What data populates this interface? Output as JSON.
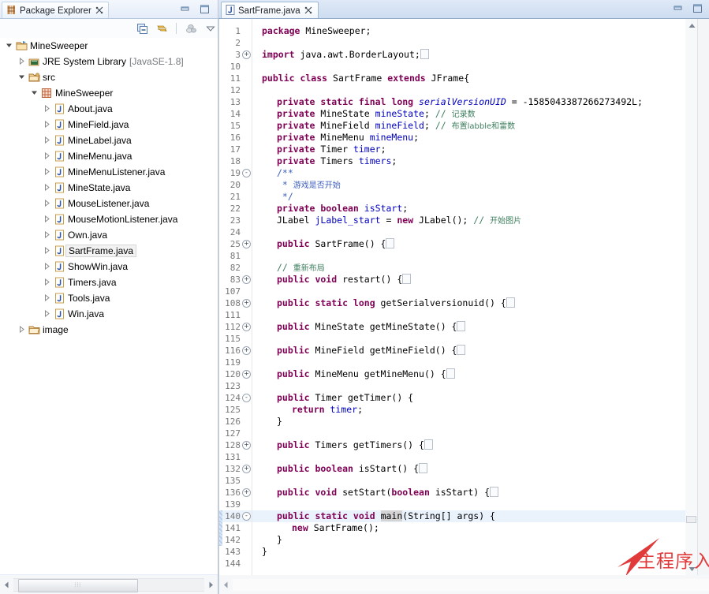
{
  "window": {
    "minimize_icon": "minimize-icon",
    "maximize_icon": "maximize-icon"
  },
  "package_explorer": {
    "tab_label": "Package Explorer",
    "tab_icon": "package-explorer-icon",
    "close_icon": "✕",
    "toolbar": [
      {
        "name": "collapse-all-button",
        "icon": "collapse-all-icon"
      },
      {
        "name": "link-with-editor-button",
        "icon": "link-editor-icon"
      },
      {
        "name": "focus-on-active-task-button",
        "icon": "focus-task-icon"
      },
      {
        "name": "view-menu-button",
        "icon": "chevron-down-icon"
      }
    ],
    "tree": [
      {
        "indent": 0,
        "twisty": "▾",
        "icon": "project-icon",
        "label": "MineSweeper",
        "dim": "",
        "selected": false
      },
      {
        "indent": 1,
        "twisty": "▸",
        "icon": "jre-library-icon",
        "label": "JRE System Library",
        "dim": "[JavaSE-1.8]",
        "selected": false
      },
      {
        "indent": 1,
        "twisty": "▾",
        "icon": "source-folder-icon",
        "label": "src",
        "dim": "",
        "selected": false
      },
      {
        "indent": 2,
        "twisty": "▾",
        "icon": "package-icon",
        "label": "MineSweeper",
        "dim": "",
        "selected": false
      },
      {
        "indent": 3,
        "twisty": "▸",
        "icon": "java-file-icon",
        "label": "About.java",
        "dim": "",
        "selected": false
      },
      {
        "indent": 3,
        "twisty": "▸",
        "icon": "java-file-icon",
        "label": "MineField.java",
        "dim": "",
        "selected": false
      },
      {
        "indent": 3,
        "twisty": "▸",
        "icon": "java-file-icon",
        "label": "MineLabel.java",
        "dim": "",
        "selected": false
      },
      {
        "indent": 3,
        "twisty": "▸",
        "icon": "java-file-icon",
        "label": "MineMenu.java",
        "dim": "",
        "selected": false
      },
      {
        "indent": 3,
        "twisty": "▸",
        "icon": "java-file-icon",
        "label": "MineMenuListener.java",
        "dim": "",
        "selected": false
      },
      {
        "indent": 3,
        "twisty": "▸",
        "icon": "java-file-icon",
        "label": "MineState.java",
        "dim": "",
        "selected": false
      },
      {
        "indent": 3,
        "twisty": "▸",
        "icon": "java-file-icon",
        "label": "MouseListener.java",
        "dim": "",
        "selected": false
      },
      {
        "indent": 3,
        "twisty": "▸",
        "icon": "java-file-icon",
        "label": "MouseMotionListener.java",
        "dim": "",
        "selected": false
      },
      {
        "indent": 3,
        "twisty": "▸",
        "icon": "java-file-icon",
        "label": "Own.java",
        "dim": "",
        "selected": false
      },
      {
        "indent": 3,
        "twisty": "▸",
        "icon": "java-file-icon",
        "label": "SartFrame.java",
        "dim": "",
        "selected": true
      },
      {
        "indent": 3,
        "twisty": "▸",
        "icon": "java-file-icon",
        "label": "ShowWin.java",
        "dim": "",
        "selected": false
      },
      {
        "indent": 3,
        "twisty": "▸",
        "icon": "java-file-icon",
        "label": "Timers.java",
        "dim": "",
        "selected": false
      },
      {
        "indent": 3,
        "twisty": "▸",
        "icon": "java-file-icon",
        "label": "Tools.java",
        "dim": "",
        "selected": false
      },
      {
        "indent": 3,
        "twisty": "▸",
        "icon": "java-file-icon",
        "label": "Win.java",
        "dim": "",
        "selected": false
      },
      {
        "indent": 1,
        "twisty": "▸",
        "icon": "folder-icon",
        "label": "image",
        "dim": "",
        "selected": false
      }
    ],
    "hscroll": {
      "left_arrow": "◀",
      "right_arrow": "▶",
      "grip": "⦙⦙⦙"
    }
  },
  "editor": {
    "tab_label": "SartFrame.java",
    "tab_icon": "java-file-icon",
    "close_icon": "✕",
    "vscroll": {
      "up_arrow": "▲",
      "down_arrow": "▼"
    },
    "hscroll": {
      "left_arrow": "◁"
    },
    "lines": [
      {
        "n": "1",
        "fold": "",
        "indent": 0,
        "hl": false,
        "changed": false,
        "tokens": [
          {
            "t": "kw",
            "v": "package"
          },
          {
            "t": "plain",
            "v": " MineSweeper;"
          }
        ]
      },
      {
        "n": "2",
        "fold": "",
        "indent": 0,
        "hl": false,
        "changed": false,
        "tokens": []
      },
      {
        "n": "3",
        "fold": "+",
        "indent": 0,
        "hl": false,
        "changed": false,
        "tokens": [
          {
            "t": "kw",
            "v": "import"
          },
          {
            "t": "plain",
            "v": " java.awt.BorderLayout;"
          },
          {
            "t": "box",
            "v": ""
          }
        ]
      },
      {
        "n": "10",
        "fold": "",
        "indent": 0,
        "hl": false,
        "changed": false,
        "tokens": []
      },
      {
        "n": "11",
        "fold": "",
        "indent": 0,
        "hl": false,
        "changed": false,
        "tokens": [
          {
            "t": "kw",
            "v": "public class"
          },
          {
            "t": "plain",
            "v": " SartFrame "
          },
          {
            "t": "kw",
            "v": "extends"
          },
          {
            "t": "plain",
            "v": " JFrame{"
          }
        ]
      },
      {
        "n": "12",
        "fold": "",
        "indent": 0,
        "hl": false,
        "changed": false,
        "tokens": []
      },
      {
        "n": "13",
        "fold": "",
        "indent": 1,
        "hl": false,
        "changed": false,
        "tokens": [
          {
            "t": "kw",
            "v": "private static final long"
          },
          {
            "t": "plain",
            "v": " "
          },
          {
            "t": "stat",
            "v": "serialVersionUID"
          },
          {
            "t": "plain",
            "v": " = -1585043387266273492L;"
          }
        ]
      },
      {
        "n": "14",
        "fold": "",
        "indent": 1,
        "hl": false,
        "changed": false,
        "tokens": [
          {
            "t": "kw",
            "v": "private"
          },
          {
            "t": "plain",
            "v": " MineState "
          },
          {
            "t": "fld",
            "v": "mineState"
          },
          {
            "t": "plain",
            "v": "; "
          },
          {
            "t": "cmt",
            "v": "// "
          },
          {
            "t": "cmtcjk",
            "v": "记录数"
          }
        ]
      },
      {
        "n": "15",
        "fold": "",
        "indent": 1,
        "hl": false,
        "changed": false,
        "tokens": [
          {
            "t": "kw",
            "v": "private"
          },
          {
            "t": "plain",
            "v": " MineField "
          },
          {
            "t": "fld",
            "v": "mineField"
          },
          {
            "t": "plain",
            "v": "; "
          },
          {
            "t": "cmt",
            "v": "// "
          },
          {
            "t": "cmtcjk",
            "v": "布置labble和雷数"
          }
        ]
      },
      {
        "n": "16",
        "fold": "",
        "indent": 1,
        "hl": false,
        "changed": false,
        "tokens": [
          {
            "t": "kw",
            "v": "private"
          },
          {
            "t": "plain",
            "v": " MineMenu "
          },
          {
            "t": "fld",
            "v": "mineMenu"
          },
          {
            "t": "plain",
            "v": ";"
          }
        ]
      },
      {
        "n": "17",
        "fold": "",
        "indent": 1,
        "hl": false,
        "changed": false,
        "tokens": [
          {
            "t": "kw",
            "v": "private"
          },
          {
            "t": "plain",
            "v": " Timer "
          },
          {
            "t": "fld",
            "v": "timer"
          },
          {
            "t": "plain",
            "v": ";"
          }
        ]
      },
      {
        "n": "18",
        "fold": "",
        "indent": 1,
        "hl": false,
        "changed": false,
        "tokens": [
          {
            "t": "kw",
            "v": "private"
          },
          {
            "t": "plain",
            "v": " Timers "
          },
          {
            "t": "fld",
            "v": "timers"
          },
          {
            "t": "plain",
            "v": ";"
          }
        ]
      },
      {
        "n": "19",
        "fold": "-",
        "indent": 1,
        "hl": false,
        "changed": false,
        "tokens": [
          {
            "t": "jdoc",
            "v": "/**"
          }
        ]
      },
      {
        "n": "20",
        "fold": "",
        "indent": 1,
        "hl": false,
        "changed": false,
        "tokens": [
          {
            "t": "jdoc",
            "v": " * "
          },
          {
            "t": "jdoccjk",
            "v": "游戏是否开始"
          }
        ]
      },
      {
        "n": "21",
        "fold": "",
        "indent": 1,
        "hl": false,
        "changed": false,
        "tokens": [
          {
            "t": "jdoc",
            "v": " */"
          }
        ]
      },
      {
        "n": "22",
        "fold": "",
        "indent": 1,
        "hl": false,
        "changed": false,
        "tokens": [
          {
            "t": "kw",
            "v": "private boolean"
          },
          {
            "t": "plain",
            "v": " "
          },
          {
            "t": "fld",
            "v": "isStart"
          },
          {
            "t": "plain",
            "v": ";"
          }
        ]
      },
      {
        "n": "23",
        "fold": "",
        "indent": 1,
        "hl": false,
        "changed": false,
        "tokens": [
          {
            "t": "plain",
            "v": "JLabel "
          },
          {
            "t": "fld",
            "v": "jLabel_start"
          },
          {
            "t": "plain",
            "v": " = "
          },
          {
            "t": "kw",
            "v": "new"
          },
          {
            "t": "plain",
            "v": " JLabel(); "
          },
          {
            "t": "cmt",
            "v": "// "
          },
          {
            "t": "cmtcjk",
            "v": "开始图片"
          }
        ]
      },
      {
        "n": "24",
        "fold": "",
        "indent": 0,
        "hl": false,
        "changed": false,
        "tokens": []
      },
      {
        "n": "25",
        "fold": "+",
        "indent": 1,
        "hl": false,
        "changed": false,
        "tokens": [
          {
            "t": "kw",
            "v": "public"
          },
          {
            "t": "plain",
            "v": " SartFrame() {"
          },
          {
            "t": "box",
            "v": ""
          }
        ]
      },
      {
        "n": "81",
        "fold": "",
        "indent": 0,
        "hl": false,
        "changed": false,
        "tokens": []
      },
      {
        "n": "82",
        "fold": "",
        "indent": 1,
        "hl": false,
        "changed": false,
        "tokens": [
          {
            "t": "cmt",
            "v": "// "
          },
          {
            "t": "cmtcjk",
            "v": "重新布局"
          }
        ]
      },
      {
        "n": "83",
        "fold": "+",
        "indent": 1,
        "hl": false,
        "changed": false,
        "tokens": [
          {
            "t": "kw",
            "v": "public void"
          },
          {
            "t": "plain",
            "v": " restart() {"
          },
          {
            "t": "box",
            "v": ""
          }
        ]
      },
      {
        "n": "107",
        "fold": "",
        "indent": 0,
        "hl": false,
        "changed": false,
        "tokens": []
      },
      {
        "n": "108",
        "fold": "+",
        "indent": 1,
        "hl": false,
        "changed": false,
        "tokens": [
          {
            "t": "kw",
            "v": "public static long"
          },
          {
            "t": "plain",
            "v": " getSerialversionuid() {"
          },
          {
            "t": "box",
            "v": ""
          }
        ]
      },
      {
        "n": "111",
        "fold": "",
        "indent": 0,
        "hl": false,
        "changed": false,
        "tokens": []
      },
      {
        "n": "112",
        "fold": "+",
        "indent": 1,
        "hl": false,
        "changed": false,
        "tokens": [
          {
            "t": "kw",
            "v": "public"
          },
          {
            "t": "plain",
            "v": " MineState getMineState() {"
          },
          {
            "t": "box",
            "v": ""
          }
        ]
      },
      {
        "n": "115",
        "fold": "",
        "indent": 0,
        "hl": false,
        "changed": false,
        "tokens": []
      },
      {
        "n": "116",
        "fold": "+",
        "indent": 1,
        "hl": false,
        "changed": false,
        "tokens": [
          {
            "t": "kw",
            "v": "public"
          },
          {
            "t": "plain",
            "v": " MineField getMineField() {"
          },
          {
            "t": "box",
            "v": ""
          }
        ]
      },
      {
        "n": "119",
        "fold": "",
        "indent": 0,
        "hl": false,
        "changed": false,
        "tokens": []
      },
      {
        "n": "120",
        "fold": "+",
        "indent": 1,
        "hl": false,
        "changed": false,
        "tokens": [
          {
            "t": "kw",
            "v": "public"
          },
          {
            "t": "plain",
            "v": " MineMenu getMineMenu() {"
          },
          {
            "t": "box",
            "v": ""
          }
        ]
      },
      {
        "n": "123",
        "fold": "",
        "indent": 0,
        "hl": false,
        "changed": false,
        "tokens": []
      },
      {
        "n": "124",
        "fold": "-",
        "indent": 1,
        "hl": false,
        "changed": false,
        "tokens": [
          {
            "t": "kw",
            "v": "public"
          },
          {
            "t": "plain",
            "v": " Timer getTimer() {"
          }
        ]
      },
      {
        "n": "125",
        "fold": "",
        "indent": 2,
        "hl": false,
        "changed": false,
        "tokens": [
          {
            "t": "kw",
            "v": "return"
          },
          {
            "t": "plain",
            "v": " "
          },
          {
            "t": "fld",
            "v": "timer"
          },
          {
            "t": "plain",
            "v": ";"
          }
        ]
      },
      {
        "n": "126",
        "fold": "",
        "indent": 1,
        "hl": false,
        "changed": false,
        "tokens": [
          {
            "t": "plain",
            "v": "}"
          }
        ]
      },
      {
        "n": "127",
        "fold": "",
        "indent": 0,
        "hl": false,
        "changed": false,
        "tokens": []
      },
      {
        "n": "128",
        "fold": "+",
        "indent": 1,
        "hl": false,
        "changed": false,
        "tokens": [
          {
            "t": "kw",
            "v": "public"
          },
          {
            "t": "plain",
            "v": " Timers getTimers() {"
          },
          {
            "t": "box",
            "v": ""
          }
        ]
      },
      {
        "n": "131",
        "fold": "",
        "indent": 0,
        "hl": false,
        "changed": false,
        "tokens": []
      },
      {
        "n": "132",
        "fold": "+",
        "indent": 1,
        "hl": false,
        "changed": false,
        "tokens": [
          {
            "t": "kw",
            "v": "public boolean"
          },
          {
            "t": "plain",
            "v": " isStart() {"
          },
          {
            "t": "box",
            "v": ""
          }
        ]
      },
      {
        "n": "135",
        "fold": "",
        "indent": 0,
        "hl": false,
        "changed": false,
        "tokens": []
      },
      {
        "n": "136",
        "fold": "+",
        "indent": 1,
        "hl": false,
        "changed": false,
        "tokens": [
          {
            "t": "kw",
            "v": "public void"
          },
          {
            "t": "plain",
            "v": " setStart("
          },
          {
            "t": "kw",
            "v": "boolean"
          },
          {
            "t": "plain",
            "v": " isStart) {"
          },
          {
            "t": "box",
            "v": ""
          }
        ]
      },
      {
        "n": "139",
        "fold": "",
        "indent": 0,
        "hl": false,
        "changed": false,
        "tokens": []
      },
      {
        "n": "140",
        "fold": "-",
        "indent": 1,
        "hl": true,
        "changed": true,
        "tokens": [
          {
            "t": "kw",
            "v": "public static void"
          },
          {
            "t": "plain",
            "v": " "
          },
          {
            "t": "sel",
            "v": "main"
          },
          {
            "t": "plain",
            "v": "(String[] args) {"
          }
        ]
      },
      {
        "n": "141",
        "fold": "",
        "indent": 2,
        "hl": false,
        "changed": true,
        "tokens": [
          {
            "t": "kw",
            "v": "new"
          },
          {
            "t": "plain",
            "v": " SartFrame();"
          }
        ]
      },
      {
        "n": "142",
        "fold": "",
        "indent": 1,
        "hl": false,
        "changed": true,
        "tokens": [
          {
            "t": "plain",
            "v": "}"
          }
        ]
      },
      {
        "n": "143",
        "fold": "",
        "indent": 0,
        "hl": false,
        "changed": false,
        "tokens": [
          {
            "t": "plain",
            "v": "}"
          }
        ]
      },
      {
        "n": "144",
        "fold": "",
        "indent": 0,
        "hl": false,
        "changed": false,
        "tokens": []
      }
    ],
    "annotation": {
      "text": "主程序入口",
      "color": "#e03a3a",
      "arrow_name": "red-arrow-annotation"
    }
  }
}
